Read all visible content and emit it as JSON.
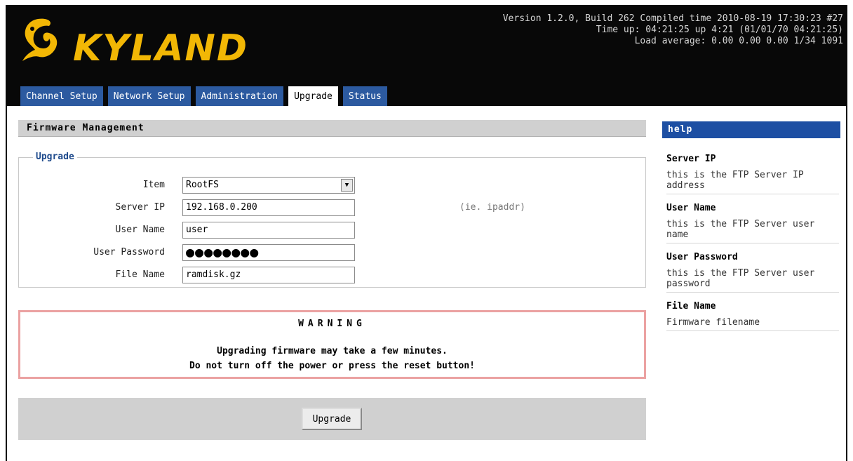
{
  "header": {
    "logo_text": "KYLAND",
    "version_line1": "Version 1.2.0, Build 262 Compiled time 2010-08-19 17:30:23 #27",
    "version_line2": "Time up: 04:21:25 up 4:21 (01/01/70 04:21:25)",
    "version_line3": "Load average: 0.00 0.00 0.00 1/34 1091"
  },
  "tabs": [
    {
      "label": "Channel Setup"
    },
    {
      "label": "Network Setup"
    },
    {
      "label": "Administration"
    },
    {
      "label": "Upgrade"
    },
    {
      "label": "Status"
    }
  ],
  "main": {
    "section_title": "Firmware Management",
    "fieldset_legend": "Upgrade",
    "fields": {
      "item_label": "Item",
      "item_value": "RootFS",
      "server_ip_label": "Server IP",
      "server_ip_value": "192.168.0.200",
      "server_ip_hint": "(ie. ipaddr)",
      "user_name_label": "User Name",
      "user_name_value": "user",
      "user_password_label": "User Password",
      "user_password_masked": "●●●●●●●●",
      "file_name_label": "File Name",
      "file_name_value": "ramdisk.gz"
    },
    "warning": {
      "title": "WARNING",
      "line1": "Upgrading firmware may take a few minutes.",
      "line2": "Do not turn off the power or press the reset button!"
    },
    "upgrade_button": "Upgrade"
  },
  "help": {
    "title": "help",
    "items": [
      {
        "heading": "Server IP",
        "desc": "this is the FTP Server IP address"
      },
      {
        "heading": "User Name",
        "desc": "this is the FTP Server user name"
      },
      {
        "heading": "User Password",
        "desc": "this is the FTP Server user password"
      },
      {
        "heading": "File Name",
        "desc": "Firmware filename"
      }
    ]
  },
  "colors": {
    "header_bg": "#080808",
    "logo": "#f2b705",
    "tab_bg": "#2c5aa0",
    "help_title_bg": "#1d4fa3",
    "warning_border": "#eba2a2"
  }
}
